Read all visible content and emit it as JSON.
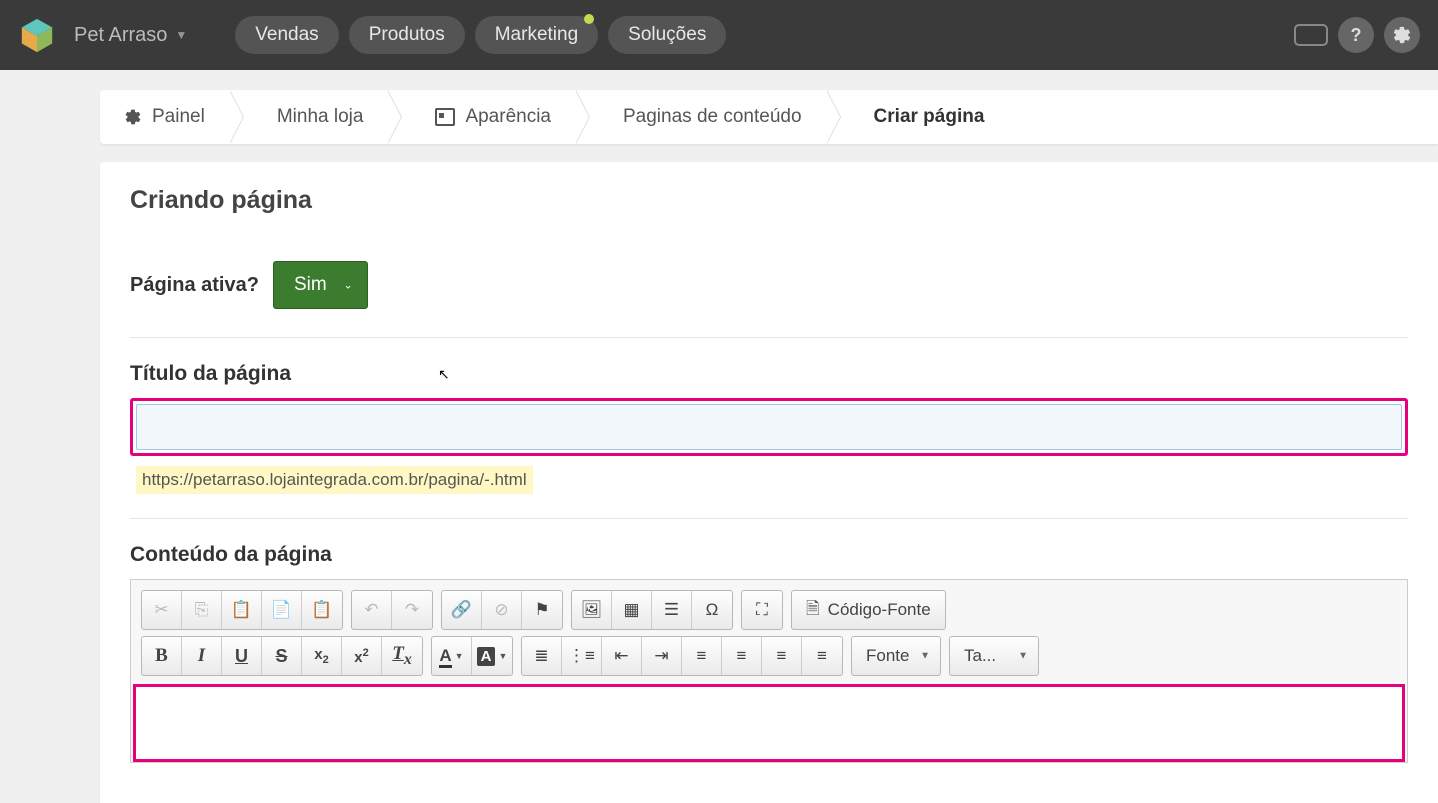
{
  "topbar": {
    "store_name": "Pet Arraso",
    "nav": [
      {
        "label": "Vendas",
        "has_dot": false
      },
      {
        "label": "Produtos",
        "has_dot": false
      },
      {
        "label": "Marketing",
        "has_dot": true
      },
      {
        "label": "Soluções",
        "has_dot": false
      }
    ],
    "help_symbol": "?"
  },
  "breadcrumb": {
    "items": [
      {
        "label": "Painel",
        "icon": "gear"
      },
      {
        "label": "Minha loja",
        "icon": null
      },
      {
        "label": "Aparência",
        "icon": "calendar"
      },
      {
        "label": "Paginas de conteúdo",
        "icon": null
      },
      {
        "label": "Criar página",
        "icon": null,
        "active": true
      }
    ]
  },
  "page": {
    "header": "Criando página",
    "active_label": "Página ativa?",
    "active_value": "Sim",
    "title_label": "Título da página",
    "title_value": "",
    "url_hint": "https://petarraso.lojaintegrada.com.br/pagina/-.html",
    "content_label": "Conteúdo da página",
    "content_value": ""
  },
  "editor": {
    "source_label": "Código-Fonte",
    "font_label": "Fonte",
    "size_label": "Ta...",
    "icons_row1": {
      "g1": [
        "cut",
        "copy",
        "paste",
        "paste-text",
        "paste-word"
      ],
      "g2": [
        "undo",
        "redo"
      ],
      "g3": [
        "link",
        "unlink",
        "anchor"
      ],
      "g4": [
        "image",
        "table",
        "hr",
        "special-char"
      ],
      "g5": [
        "maximize"
      ],
      "g6": [
        "source"
      ]
    },
    "icons_row2": {
      "g1": [
        "bold",
        "italic",
        "underline",
        "strike",
        "subscript",
        "superscript",
        "remove-format"
      ],
      "g2": [
        "text-color",
        "bg-color"
      ],
      "g3": [
        "ol",
        "ul",
        "outdent",
        "indent",
        "align-left",
        "align-center",
        "align-right",
        "justify"
      ]
    }
  },
  "colors": {
    "highlight": "#e6007e",
    "green": "#3b7c2f"
  }
}
